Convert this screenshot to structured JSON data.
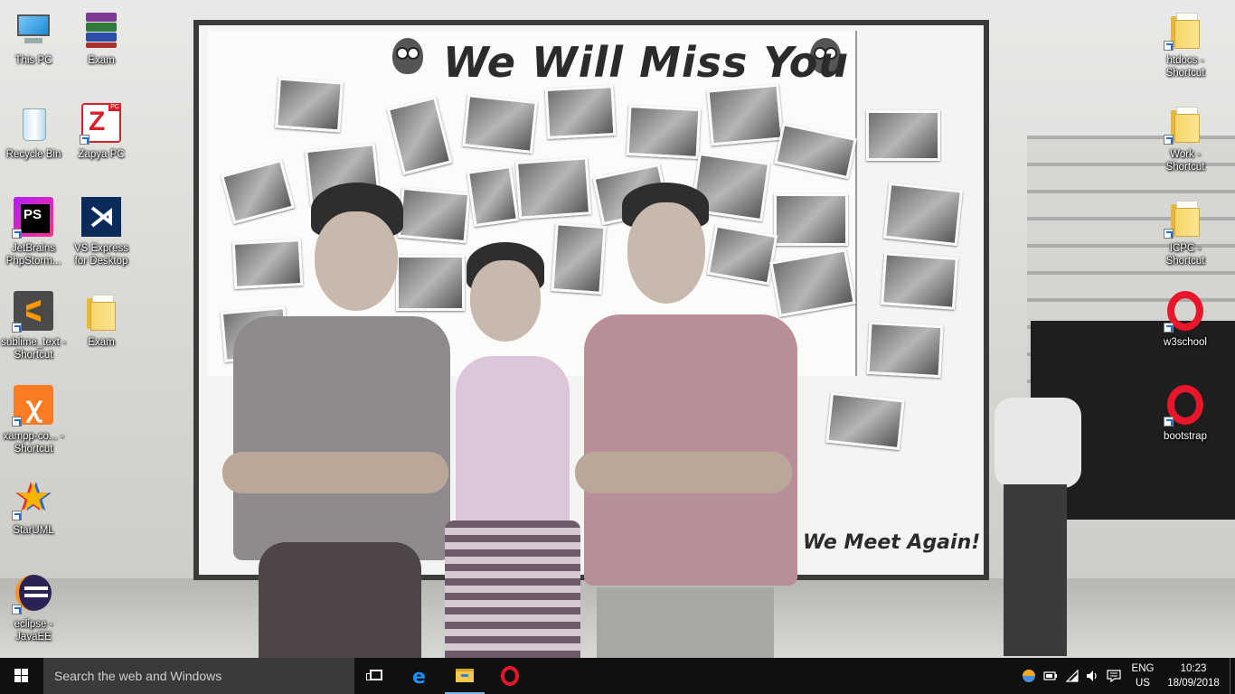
{
  "wallpaper": {
    "banner_text": "We Will Miss You",
    "bottom_text": "May We Meet Again!"
  },
  "desktop": {
    "left_icons": [
      {
        "label": "This PC",
        "icon": "computer-icon"
      },
      {
        "label": "Exam",
        "icon": "winrar-archive-icon"
      },
      {
        "label": "Recycle Bin",
        "icon": "recycle-bin-icon"
      },
      {
        "label": "Zapya PC",
        "icon": "zapya-icon"
      },
      {
        "label": "JetBrains PhpStorm...",
        "icon": "phpstorm-icon"
      },
      {
        "label": "VS Express for Desktop",
        "icon": "visual-studio-icon"
      },
      {
        "label": "sublime_text - Shortcut",
        "icon": "sublime-text-icon"
      },
      {
        "label": "Exam",
        "icon": "folder-icon"
      },
      {
        "label": "xampp-co... - Shortcut",
        "icon": "xampp-icon"
      },
      {
        "label": "StarUML",
        "icon": "staruml-icon"
      },
      {
        "label": "eclipse - JavaEE",
        "icon": "eclipse-icon"
      }
    ],
    "right_icons": [
      {
        "label": "htdocs - Shortcut",
        "icon": "folder-icon"
      },
      {
        "label": "Work - Shortcut",
        "icon": "folder-icon"
      },
      {
        "label": "ICPC - Shortcut",
        "icon": "folder-icon"
      },
      {
        "label": "w3school",
        "icon": "opera-icon"
      },
      {
        "label": "bootstrap",
        "icon": "opera-icon"
      }
    ]
  },
  "taskbar": {
    "search_placeholder": "Search the web and Windows",
    "pinned": [
      {
        "name": "task-view",
        "icon": "task-view-icon"
      },
      {
        "name": "edge",
        "icon": "edge-icon"
      },
      {
        "name": "file-explorer",
        "icon": "file-explorer-icon"
      },
      {
        "name": "opera",
        "icon": "opera-icon"
      }
    ],
    "tray": {
      "icons": [
        "network-app-icon",
        "battery-icon",
        "wifi-icon",
        "volume-icon",
        "action-center-icon"
      ],
      "language_line1": "ENG",
      "language_line2": "US",
      "time": "10:23",
      "date": "18/09/2018"
    }
  },
  "colors": {
    "taskbar_bg": "#101010",
    "search_bg": "#3a3a3a",
    "accent": "#76b9ed",
    "opera_red": "#e8162a"
  }
}
